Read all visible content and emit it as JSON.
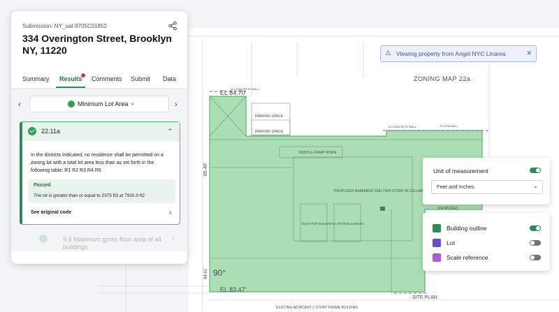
{
  "plan": {
    "labels": [
      "ZONING MAP 22a",
      "EL 84.70'",
      "EL 83.47'",
      "PARKING SPACE",
      "VEHICLE RAMP DOWN",
      "PROPOSED BASEMENT AND TWO STORY IN CELLAR",
      "ELEVATOR BULKHEAD",
      "STAIR BULKHEAD",
      "PROPOSED",
      "SITE PLAN",
      "EXISTING ADJACENT 2 STORY FRAME BUILDING",
      "85.40'",
      "84.61'",
      "90°",
      "1/2 CONCRETE WALL",
      "FLOOD WALL"
    ],
    "colors": {
      "building_fill": "#9ed8a6",
      "building_stroke": "#5bb570",
      "lot": "#7a59c9"
    }
  },
  "panel": {
    "submission": "Submission: NY_uat-9705C01852",
    "address": "334 Overington Street, Brooklyn NY, 11220",
    "tabs": [
      "Summary",
      "Results",
      "Comments",
      "Submit",
      "Data"
    ],
    "selector": {
      "label": "Minimum Lot Area",
      "prev": "‹",
      "next": "›",
      "chevron": "⌄"
    },
    "rule": {
      "code": "22.11a",
      "text": "In the districts indicated, no residence shall be permitted on a zoning lot with a total lot area less than as set forth in the following table: R1 R2 R3 R4 R5",
      "status": "Passed",
      "result": "The lot is greater than or equal to 2375 ft3 at 7920.9 ft2",
      "link": "See original code",
      "collapse": "⌃",
      "link_arrow": "›"
    },
    "next_rule": {
      "text": "9.9 Maximum gross floor area of all buildings",
      "arrow": "›"
    }
  },
  "toast": {
    "icon": "⚠",
    "text": "Viewing property from Angel NYC Linares",
    "close": "✕"
  },
  "units": {
    "label": "Unit of measurement",
    "value": "Feet and Inches",
    "chevron": "⌄",
    "enabled": true
  },
  "layers": [
    {
      "name": "Building outline",
      "color": "#2e8b57",
      "on": true
    },
    {
      "name": "Lot",
      "color": "#6a4fc4",
      "on": false
    },
    {
      "name": "Scale reference",
      "color": "#b05ad6",
      "on": false
    }
  ]
}
